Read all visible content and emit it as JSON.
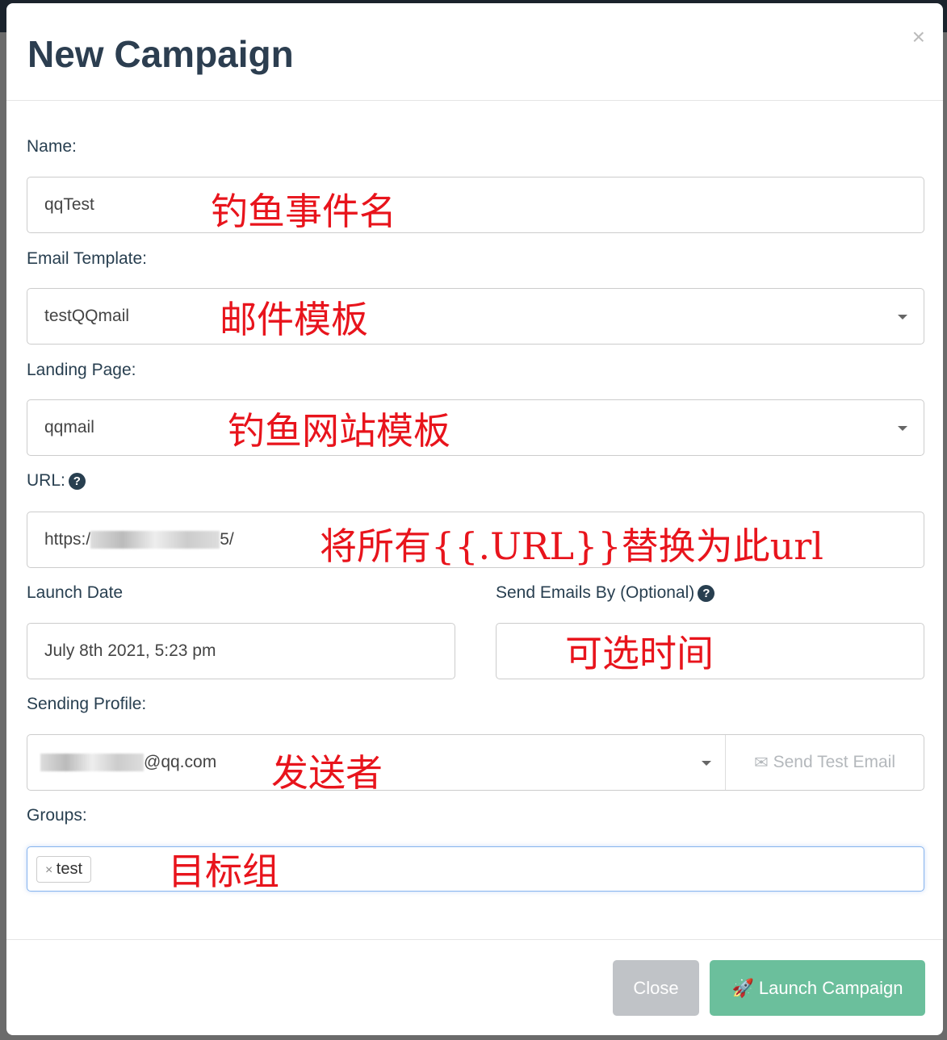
{
  "modal": {
    "title": "New Campaign",
    "close_icon": "×"
  },
  "fields": {
    "name": {
      "label": "Name:",
      "value": "qqTest",
      "note": "钓鱼事件名"
    },
    "email_template": {
      "label": "Email Template:",
      "value": "testQQmail",
      "note": "邮件模板"
    },
    "landing_page": {
      "label": "Landing Page:",
      "value": "qqmail",
      "note": "钓鱼网站模板"
    },
    "url": {
      "label": "URL:",
      "value_prefix": "https:/",
      "value_suffix": "5/",
      "note": "将所有{{.URL}}替换为此url"
    },
    "launch_date": {
      "label": "Launch Date",
      "value": "July 8th 2021, 5:23 pm"
    },
    "send_by": {
      "label": "Send Emails By (Optional)",
      "value": "",
      "note": "可选时间"
    },
    "sending_profile": {
      "label": "Sending Profile:",
      "value_suffix": "@qq.com",
      "note": "发送者",
      "send_test_label": "Send Test Email"
    },
    "groups": {
      "label": "Groups:",
      "tags": [
        "test"
      ],
      "note": "目标组"
    }
  },
  "footer": {
    "close_label": "Close",
    "launch_label": "Launch Campaign"
  },
  "colors": {
    "launch": "#6bbf9c",
    "close": "#c0c3c7",
    "annotation": "#e8141c"
  }
}
